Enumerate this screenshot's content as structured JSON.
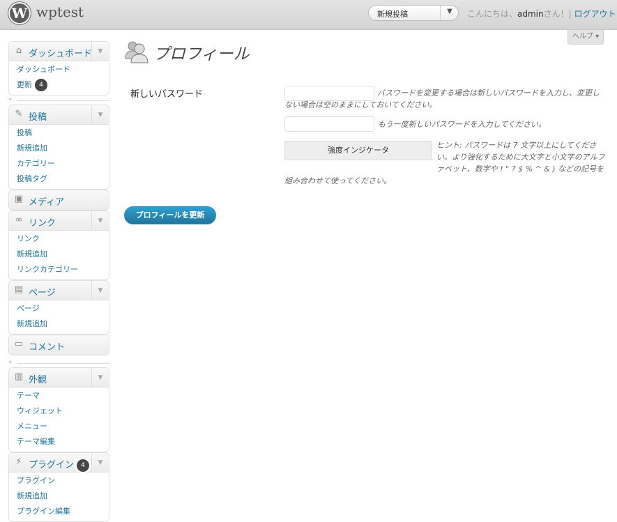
{
  "header": {
    "site_title": "wptest",
    "logo_letter": "W",
    "favorite_actions": {
      "first": "新規投稿",
      "toggle": "▼"
    },
    "greeting_prefix": "こんにちは、",
    "username": "admin",
    "greeting_suffix": "さん！| ",
    "logout": "ログアウト"
  },
  "help_tab": "ヘルプ ▾",
  "page": {
    "title": "プロフィール",
    "password_label": "新しいパスワード",
    "password_desc": "パスワードを変更する場合は新しいパスワードを入力し、変更しない場合は空のままにしておいてください。",
    "password_confirm_desc": "もう一度新しいパスワードを入力してください。",
    "strength_indicator": "強度インジケータ",
    "hint": "ヒント: パスワードは 7 文字以上にしてください。より強化するために大文字と小文字のアルファベット、数字や ! \" ? $ % ^ & ) などの記号を組み合わせて使ってください。",
    "submit": "プロフィールを更新"
  },
  "sidebar": {
    "dashboard": {
      "label": "ダッシュボード",
      "items": [
        "ダッシュボード",
        "更新"
      ],
      "update_badge": "4"
    },
    "posts": {
      "label": "投稿",
      "items": [
        "投稿",
        "新規追加",
        "カテゴリー",
        "投稿タグ"
      ]
    },
    "media": {
      "label": "メディア"
    },
    "links": {
      "label": "リンク",
      "items": [
        "リンク",
        "新規追加",
        "リンクカテゴリー"
      ]
    },
    "pages": {
      "label": "ページ",
      "items": [
        "ページ",
        "新規追加"
      ]
    },
    "comments": {
      "label": "コメント"
    },
    "appearance": {
      "label": "外観",
      "items": [
        "テーマ",
        "ウィジェット",
        "メニュー",
        "テーマ編集"
      ]
    },
    "plugins": {
      "label": "プラグイン",
      "badge": "4",
      "items": [
        "プラグイン",
        "新規追加",
        "プラグイン編集"
      ]
    },
    "collapse_arrow": "«"
  },
  "colors": {
    "link": "#21759b",
    "button": "#21759b",
    "header_bg": "#d9d9d9"
  }
}
